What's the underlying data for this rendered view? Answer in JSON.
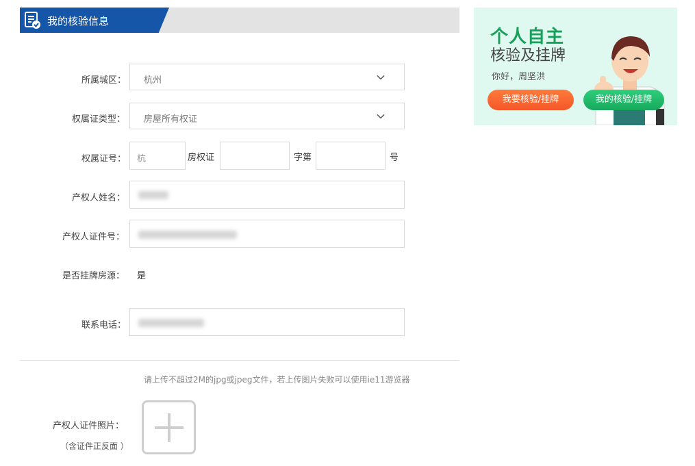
{
  "header": {
    "title": "我的核验信息"
  },
  "form": {
    "city": {
      "label": "所属城区：",
      "value": "杭州"
    },
    "cert_type": {
      "label": "权属证类型：",
      "value": "房屋所有权证"
    },
    "cert_no": {
      "label": "权属证号：",
      "prefix_placeholder": "杭",
      "text1": "房权证",
      "text2": "字第",
      "text3": "号"
    },
    "owner_name": {
      "label": "产权人姓名："
    },
    "owner_id": {
      "label": "产权人证件号："
    },
    "listed": {
      "label": "是否挂牌房源：",
      "value": "是"
    },
    "phone": {
      "label": "联系电话："
    },
    "upload_hint": "请上传不超过2M的jpg或jpeg文件，若上传图片失败可以使用ie11游览器",
    "photo": {
      "label": "产权人证件照片：",
      "sub": "（含证件正反面 ）"
    }
  },
  "banner": {
    "title1": "个人自主",
    "title2": "核验及挂牌",
    "greeting": "你好，周坚洪",
    "btn_verify": "我要核验/挂牌",
    "btn_mine": "我的核验/挂牌"
  },
  "colors": {
    "header_blue": "#1556a8",
    "green": "#16a05a",
    "orange": "#f4572a"
  }
}
